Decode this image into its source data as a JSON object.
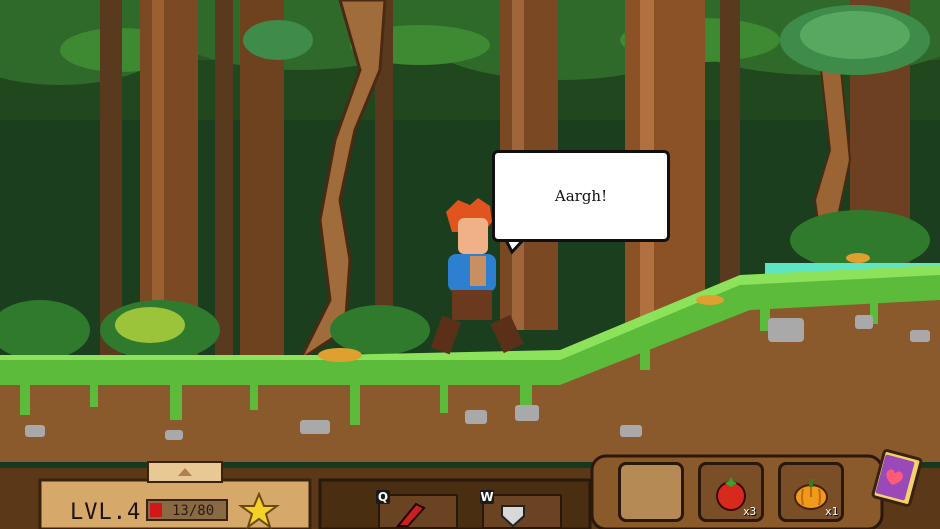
{
  "dialog": {
    "text": "Aargh!"
  },
  "hud": {
    "level_label": "LVL.4",
    "hp_text": "13/80",
    "hp_fraction": 0.1625,
    "hotkeys": [
      {
        "key": "Q",
        "item": "red-weapon-icon"
      },
      {
        "key": "W",
        "item": "shield-icon"
      }
    ],
    "inventory": [
      {
        "item": "empty-slot",
        "count": ""
      },
      {
        "item": "tomato-icon",
        "count": "x3"
      },
      {
        "item": "pumpkin-icon",
        "count": "x1"
      }
    ],
    "quest_book_icon": "book-heart-icon",
    "star_icon": "star-icon"
  }
}
